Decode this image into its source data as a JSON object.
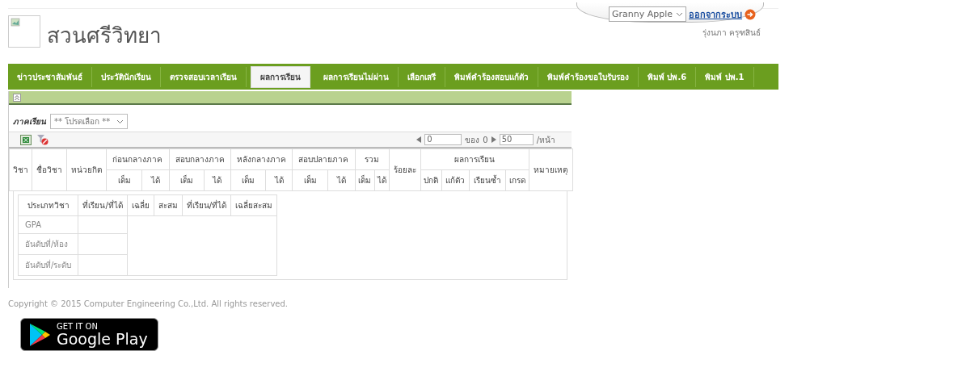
{
  "header": {
    "title": "สวนศรีวิทยา",
    "theme_select": "Granny Apple",
    "logout": "ออกจากระบบ",
    "user_name": "รุ่งนภา  ครุฑสินธ์"
  },
  "nav": [
    {
      "label": "ข่าวประชาสัมพันธ์",
      "selected": false
    },
    {
      "label": "ประวัตินักเรียน",
      "selected": false
    },
    {
      "label": "ตรวจสอบเวลาเรียน",
      "selected": false
    },
    {
      "label": "ผลการเรียน",
      "selected": true
    },
    {
      "label": "ผลการเรียนไม่ผ่าน",
      "selected": false
    },
    {
      "label": "เลือกเสรี",
      "selected": false
    },
    {
      "label": "พิมพ์คำร้องสอบแก้ตัว",
      "selected": false
    },
    {
      "label": "พิมพ์คำร้องขอใบรับรอง",
      "selected": false
    },
    {
      "label": "พิมพ์ ปพ.6",
      "selected": false
    },
    {
      "label": "พิมพ์ ปพ.1",
      "selected": false
    }
  ],
  "panel": {
    "semester_label": "ภาคเรียน",
    "semester_select": "** โปรดเลือก **",
    "pager": {
      "page": "0",
      "of_label": "ของ",
      "total": "0",
      "page_size": "50",
      "per_page_label": "/หน้า"
    },
    "grade_table": {
      "columns": [
        {
          "label": "วิชา"
        },
        {
          "label": "ชื่อวิชา"
        },
        {
          "label": "หน่วยกิต"
        },
        {
          "label": "ก่อนกลางภาค",
          "sub": [
            "เต็ม",
            "ได้"
          ]
        },
        {
          "label": "สอบกลางภาค",
          "sub": [
            "เต็ม",
            "ได้"
          ]
        },
        {
          "label": "หลังกลางภาค",
          "sub": [
            "เต็ม",
            "ได้"
          ]
        },
        {
          "label": "สอบปลายภาค",
          "sub": [
            "เต็ม",
            "ได้"
          ]
        },
        {
          "label": "รวม",
          "sub": [
            "เต็ม",
            "ได้"
          ]
        },
        {
          "label": "ร้อยละ"
        },
        {
          "label": "ผลการเรียน",
          "sub": [
            "ปกติ",
            "แก้ตัว",
            "เรียนซ้ำ",
            "เกรด"
          ]
        },
        {
          "label": "หมายเหตุ"
        }
      ]
    },
    "summary_table": {
      "columns": [
        "ประเภทวิชา",
        "ที่เรียน/ที่ได้",
        "เฉลี่ย",
        "สะสม",
        "ที่เรียน/ที่ได้",
        "เฉลี่ยสะสม"
      ],
      "rows": [
        "GPA",
        "อันดับที่/ห้อง",
        "อันดับที่/ระดับ"
      ]
    }
  },
  "footer": {
    "copyright": "Copyright © 2015 Computer Engineering Co.,Ltd. All rights reserved.",
    "store_badge": {
      "caption": "GET IT ON",
      "store": "Google Play"
    }
  }
}
